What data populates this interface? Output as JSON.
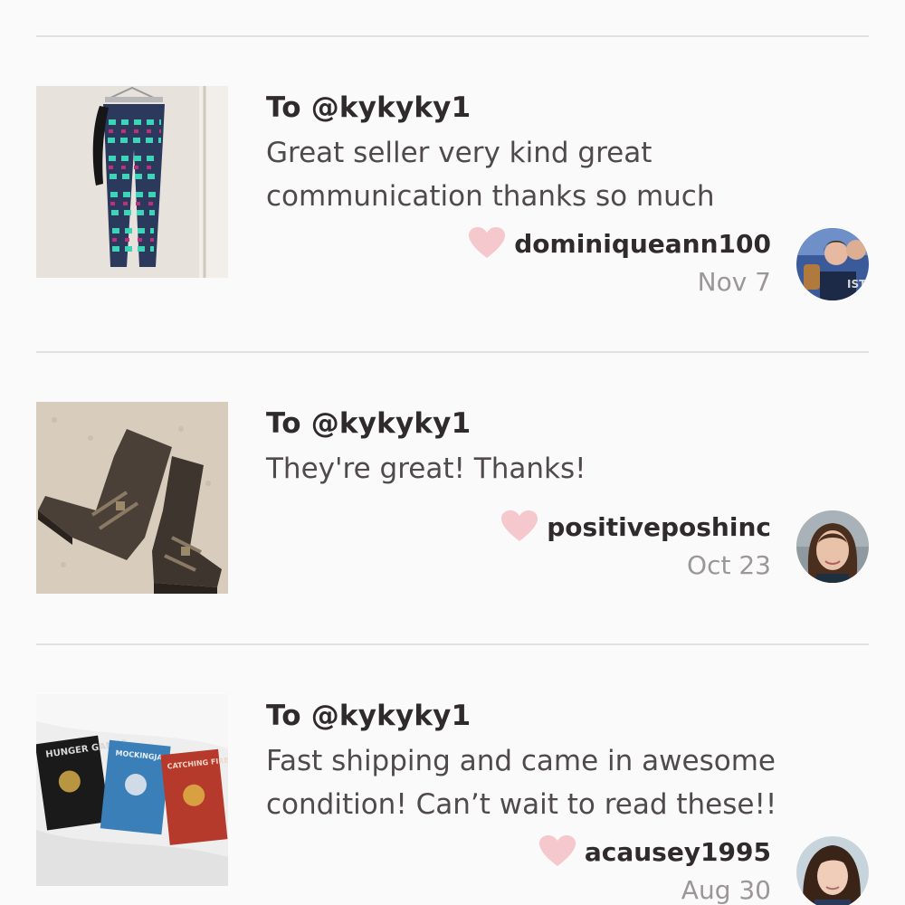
{
  "reviews": [
    {
      "to": "To @kykyky1",
      "message": "Great seller very kind great communication thanks so much",
      "username": "dominiqueann100",
      "date": "Nov 7"
    },
    {
      "to": "To @kykyky1",
      "message": "They're great! Thanks!",
      "username": "positiveposhinc",
      "date": "Oct 23"
    },
    {
      "to": "To @kykyky1",
      "message": "Fast shipping and came in awesome condition! Can’t wait to read these!!",
      "username": "acausey1995",
      "date": "Aug 30"
    }
  ],
  "book_titles": [
    "HUNGER GAMES",
    "MOCKINGJAY",
    "CATCHING FIRE"
  ],
  "colors": {
    "heart": "#f4c8cc",
    "divider": "#e3e0e1",
    "text_dark": "#2f2a2b",
    "text_body": "#4f4a4b",
    "text_muted": "#9b9697",
    "background": "#fbfafa"
  },
  "icons": {
    "like": "heart-icon"
  }
}
